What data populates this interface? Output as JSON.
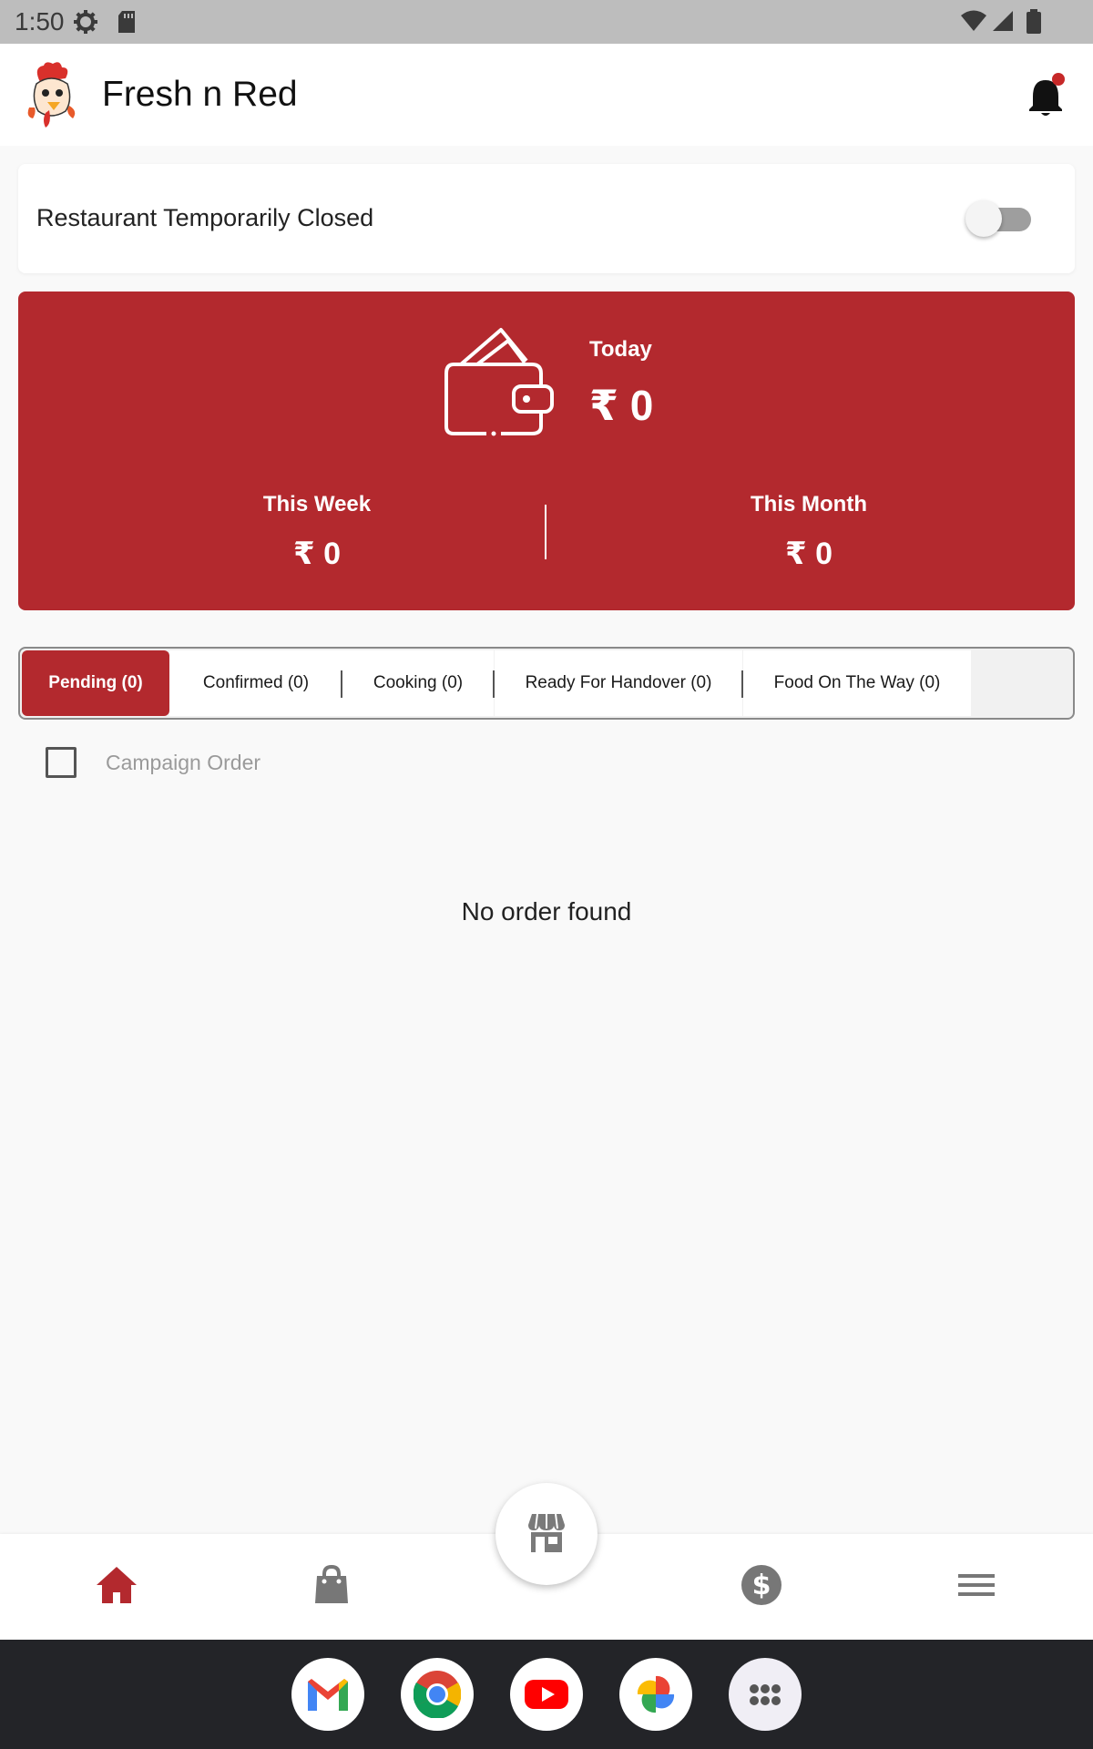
{
  "status_bar": {
    "time": "1:50"
  },
  "app_bar": {
    "title": "Fresh n Red"
  },
  "closed_card": {
    "label": "Restaurant Temporarily Closed",
    "toggle_on": false
  },
  "earnings": {
    "today_label": "Today",
    "today_value": "₹ 0",
    "week_label": "This Week",
    "week_value": "₹ 0",
    "month_label": "This Month",
    "month_value": "₹ 0"
  },
  "tabs": [
    {
      "label": "Pending (0)",
      "active": true
    },
    {
      "label": "Confirmed (0)",
      "active": false
    },
    {
      "label": "Cooking (0)",
      "active": false
    },
    {
      "label": "Ready For Handover (0)",
      "active": false
    },
    {
      "label": "Food On The Way (0)",
      "active": false
    }
  ],
  "campaign": {
    "label": "Campaign Order",
    "checked": false
  },
  "empty_message": "No order found",
  "bottom_nav": [
    "home-icon",
    "bag-icon",
    "store-icon",
    "dollar-icon",
    "menu-icon"
  ],
  "dock": [
    "gmail-icon",
    "chrome-icon",
    "youtube-icon",
    "photos-icon",
    "apps-icon"
  ],
  "colors": {
    "brand": "#b3292e",
    "background": "#f9f9f9"
  }
}
